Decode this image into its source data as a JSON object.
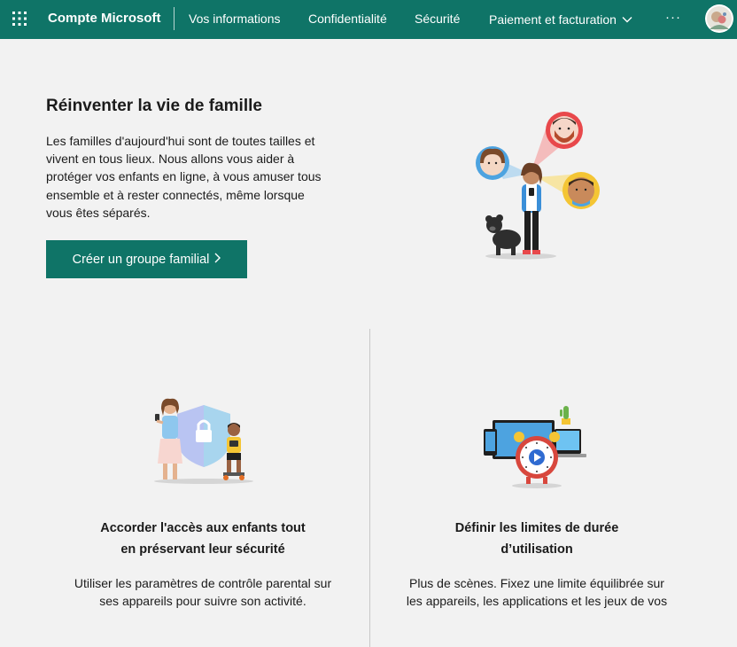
{
  "header": {
    "brand": "Compte Microsoft",
    "nav": [
      {
        "label": "Vos informations"
      },
      {
        "label": "Confidentialité"
      },
      {
        "label": "Sécurité"
      },
      {
        "label": "Paiement et facturation"
      }
    ],
    "more": "···",
    "icons": {
      "apps": "app-launcher-icon",
      "dropdown": "chevron-down-icon",
      "profile": "avatar"
    }
  },
  "hero": {
    "title": "Réinventer la vie de famille",
    "text": "Les familles d'aujourd'hui sont de toutes tailles et vivent en tous lieux. Nous allons vous aider à protéger vos enfants en ligne, à vous amuser tous ensemble et à rester connectés, même lorsque vous êtes séparés.",
    "cta": "Créer un groupe familial",
    "illustration": "family-illustration"
  },
  "cards": [
    {
      "title_line1": "Accorder l'accès aux enfants tout",
      "title_line2": "en préservant leur sécurité",
      "text": "Utiliser les paramètres de contrôle parental sur ses appareils pour suivre son activité.",
      "illustration": "parental-control-illustration"
    },
    {
      "title_line1": "Définir les limites de durée",
      "title_line2": "d’utilisation",
      "text": "Plus de scènes. Fixez une limite équilibrée sur les appareils, les applications et les jeux de vos",
      "illustration": "screen-time-illustration"
    }
  ],
  "colors": {
    "brand": "#0f7467",
    "background": "#f2f2f2"
  }
}
